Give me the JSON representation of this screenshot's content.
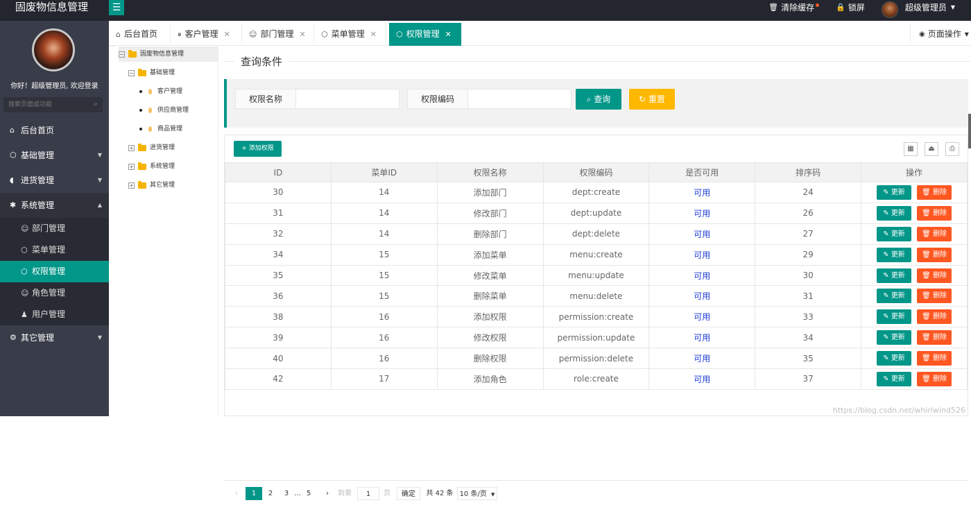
{
  "app": {
    "title": "固废物信息管理"
  },
  "topbar": {
    "clear_cache": "清除缓存",
    "lock_screen": "锁屏",
    "user_name": "超级管理员"
  },
  "sidebar": {
    "welcome": "你好！超级管理员, 欢迎登录",
    "search_placeholder": "搜索页面或功能",
    "items": [
      {
        "label": "后台首页",
        "icon": "home-icon"
      },
      {
        "label": "基础管理",
        "icon": "cube-icon"
      },
      {
        "label": "进货管理",
        "icon": "truck-icon"
      },
      {
        "label": "系统管理",
        "icon": "gear-icon"
      },
      {
        "label": "其它管理",
        "icon": "settings-icon"
      }
    ],
    "sub_items": [
      {
        "label": "部门管理",
        "icon": "user-icon"
      },
      {
        "label": "菜单管理",
        "icon": "cube-icon"
      },
      {
        "label": "权限管理",
        "icon": "cube-icon"
      },
      {
        "label": "角色管理",
        "icon": "smile-icon"
      },
      {
        "label": "用户管理",
        "icon": "user-filled-icon"
      }
    ]
  },
  "tabs": [
    {
      "label": "后台首页"
    },
    {
      "label": "客户管理"
    },
    {
      "label": "部门管理"
    },
    {
      "label": "菜单管理"
    },
    {
      "label": "权限管理"
    }
  ],
  "page_ops": "页面操作",
  "tree": {
    "root": "固废物信息管理",
    "basic": "基础管理",
    "basic_children": [
      "客户管理",
      "供应商管理",
      "商品管理"
    ],
    "others": [
      "进货管理",
      "系统管理",
      "其它管理"
    ]
  },
  "query": {
    "title": "查询条件",
    "perm_name_label": "权限名称",
    "perm_code_label": "权限编码",
    "search_btn": "查询",
    "reset_btn": "重置"
  },
  "table": {
    "add_btn": "添加权限",
    "headers": [
      "ID",
      "菜单ID",
      "权限名称",
      "权限编码",
      "是否可用",
      "排序码",
      "操作"
    ],
    "update_label": "更新",
    "delete_label": "删除",
    "rows": [
      {
        "id": "30",
        "menu_id": "14",
        "name": "添加部门",
        "code": "dept:create",
        "avail": "可用",
        "sort": "24"
      },
      {
        "id": "31",
        "menu_id": "14",
        "name": "修改部门",
        "code": "dept:update",
        "avail": "可用",
        "sort": "26"
      },
      {
        "id": "32",
        "menu_id": "14",
        "name": "删除部门",
        "code": "dept:delete",
        "avail": "可用",
        "sort": "27"
      },
      {
        "id": "34",
        "menu_id": "15",
        "name": "添加菜单",
        "code": "menu:create",
        "avail": "可用",
        "sort": "29"
      },
      {
        "id": "35",
        "menu_id": "15",
        "name": "修改菜单",
        "code": "menu:update",
        "avail": "可用",
        "sort": "30"
      },
      {
        "id": "36",
        "menu_id": "15",
        "name": "删除菜单",
        "code": "menu:delete",
        "avail": "可用",
        "sort": "31"
      },
      {
        "id": "38",
        "menu_id": "16",
        "name": "添加权限",
        "code": "permission:create",
        "avail": "可用",
        "sort": "33"
      },
      {
        "id": "39",
        "menu_id": "16",
        "name": "修改权限",
        "code": "permission:update",
        "avail": "可用",
        "sort": "34"
      },
      {
        "id": "40",
        "menu_id": "16",
        "name": "删除权限",
        "code": "permission:delete",
        "avail": "可用",
        "sort": "35"
      },
      {
        "id": "42",
        "menu_id": "17",
        "name": "添加角色",
        "code": "role:create",
        "avail": "可用",
        "sort": "37"
      }
    ]
  },
  "pager": {
    "pages": [
      "1",
      "2",
      "3",
      "…",
      "5"
    ],
    "goto_label": "到第",
    "goto_value": "1",
    "page_unit": "页",
    "confirm": "确定",
    "total": "共 42 条",
    "page_size": "10 条/页"
  },
  "watermark": "https://blog.csdn.net/whirlwind526",
  "colors": {
    "accent": "#009688",
    "warning": "#ffb800",
    "danger": "#ff5722",
    "sidebar": "#393d49",
    "topbar": "#23262e"
  }
}
